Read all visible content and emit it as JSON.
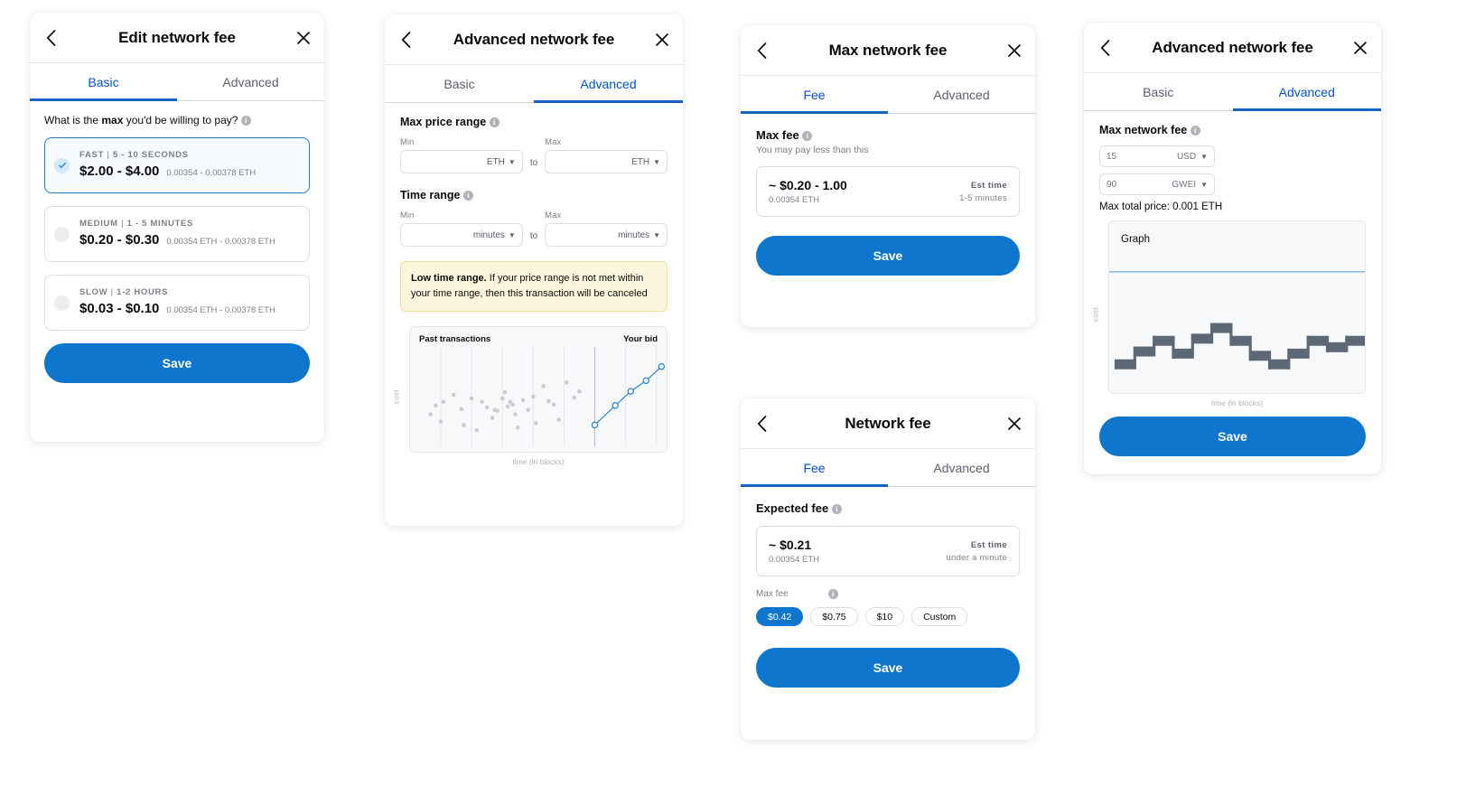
{
  "colors": {
    "accent_blue": "#0e76cc",
    "tab_active": "#0052cc",
    "tab_underline": "#1565c0",
    "warn_bg": "#fdf6dc",
    "warn_border": "#f2dfa0",
    "chart_bar": "#5d6876",
    "scatter_dot": "#c9ccd1",
    "line_blue": "#2d87d0"
  },
  "icons": {
    "back": "chevron-left-icon",
    "close": "close-icon",
    "info": "info-icon",
    "chevron_down": "chevron-down-icon",
    "check": "check-icon"
  },
  "card1": {
    "title": "Edit network fee",
    "tabs": [
      {
        "label": "Basic",
        "active": true
      },
      {
        "label": "Advanced",
        "active": false
      }
    ],
    "prompt_pre": "What is the ",
    "prompt_bold": "max",
    "prompt_post": " you'd be willing to pay?",
    "options": [
      {
        "speed": "FAST",
        "sep": " | ",
        "time": "5 - 10 SECONDS",
        "price": "$2.00 - $4.00",
        "eth": "0.00354 - 0.00378 ETH",
        "selected": true
      },
      {
        "speed": "MEDIUM",
        "sep": " | ",
        "time": "1 - 5 MINUTES",
        "price": "$0.20 - $0.30",
        "eth": "0.00354 ETH  - 0.00378 ETH",
        "selected": false
      },
      {
        "speed": "SLOW",
        "sep": " | ",
        "time": "1-2 HOURS",
        "price": "$0.03 - $0.10",
        "eth": "0.00354 ETH  - 0.00378 ETH",
        "selected": false
      }
    ],
    "save_label": "Save"
  },
  "card2": {
    "title": "Advanced network fee",
    "tabs": [
      {
        "label": "Basic",
        "active": false
      },
      {
        "label": "Advanced",
        "active": true
      }
    ],
    "price_section": {
      "title": "Max price range",
      "min_label": "Min",
      "max_label": "Max",
      "to_label": "to",
      "min_value": "",
      "min_unit": "ETH",
      "max_value": "",
      "max_unit": "ETH"
    },
    "time_section": {
      "title": "Time range",
      "min_label": "Min",
      "max_label": "Max",
      "to_label": "to",
      "min_value": "",
      "min_unit": "minutes",
      "max_value": "",
      "max_unit": "minutes"
    },
    "warning": {
      "bold": "Low time range.",
      "text": " If your price range is not met within your time range, then this transaction will be canceled"
    },
    "chart_data": {
      "type": "scatter",
      "title": "",
      "legend_left": "Past transactions",
      "legend_right": "Your bid",
      "xlabel": "time (in blocks)",
      "ylabel": "cost",
      "grid": true,
      "gridlines_x": [
        12,
        24,
        36,
        48,
        60,
        72,
        84,
        96
      ],
      "series": [
        {
          "name": "Past transactions",
          "type": "scatter",
          "points": [
            [
              8,
              30
            ],
            [
              10,
              40
            ],
            [
              12,
              22
            ],
            [
              13,
              44
            ],
            [
              17,
              52
            ],
            [
              20,
              36
            ],
            [
              21,
              18
            ],
            [
              24,
              48
            ],
            [
              26,
              12
            ],
            [
              28,
              44
            ],
            [
              30,
              38
            ],
            [
              32,
              26
            ],
            [
              33,
              35
            ],
            [
              34,
              34
            ],
            [
              36,
              48
            ],
            [
              37,
              55
            ],
            [
              38,
              39
            ],
            [
              39,
              44
            ],
            [
              40,
              41
            ],
            [
              41,
              30
            ],
            [
              42,
              15
            ],
            [
              44,
              46
            ],
            [
              46,
              35
            ],
            [
              48,
              50
            ],
            [
              49,
              20
            ],
            [
              52,
              62
            ],
            [
              54,
              45
            ],
            [
              56,
              41
            ],
            [
              58,
              24
            ],
            [
              61,
              66
            ],
            [
              64,
              49
            ],
            [
              66,
              56
            ]
          ]
        },
        {
          "name": "Your bid",
          "type": "line",
          "points": [
            [
              72,
              18
            ],
            [
              80,
              40
            ],
            [
              86,
              56
            ],
            [
              92,
              68
            ],
            [
              98,
              84
            ]
          ]
        }
      ]
    }
  },
  "card3": {
    "title": "Max network fee",
    "tabs": [
      {
        "label": "Fee",
        "active": true
      },
      {
        "label": "Advanced",
        "active": false
      }
    ],
    "heading": "Max fee",
    "subheading": "You may pay less than this",
    "fee_amount": "~ $0.20 - 1.00",
    "fee_eth": "0.00354 ETH",
    "est_label": "Est time",
    "est_value": "1-5 minutes",
    "save_label": "Save"
  },
  "card4": {
    "title": "Network fee",
    "tabs": [
      {
        "label": "Fee",
        "active": true
      },
      {
        "label": "Advanced",
        "active": false
      }
    ],
    "heading": "Expected fee",
    "fee_amount": "~ $0.21",
    "fee_eth": "0.00354 ETH",
    "est_label": "Est time",
    "est_value": "under a minute",
    "maxfee_label": "Max fee",
    "chips": [
      {
        "label": "$0.42",
        "active": true
      },
      {
        "label": "$0.75",
        "active": false
      },
      {
        "label": "$10",
        "active": false
      },
      {
        "label": "Custom",
        "active": false
      }
    ],
    "save_label": "Save"
  },
  "card5": {
    "title": "Advanced network fee",
    "tabs": [
      {
        "label": "Basic",
        "active": false
      },
      {
        "label": "Advanced",
        "active": true
      }
    ],
    "heading": "Max network fee",
    "inputs": [
      {
        "value": "15",
        "unit": "USD"
      },
      {
        "value": "90",
        "unit": "GWEI"
      }
    ],
    "total_text": "Max total price: 0.001 ETH",
    "graph_label": "Graph",
    "save_label": "Save",
    "chart_data": {
      "type": "bar",
      "title": "Graph",
      "xlabel": "time (in blocks)",
      "ylabel": "cost",
      "grid": false,
      "step_style": true,
      "threshold_line": 100,
      "categories": [
        "1",
        "2",
        "3",
        "4",
        "5",
        "6",
        "7",
        "8",
        "9",
        "10",
        "11",
        "12",
        "13"
      ],
      "values": [
        18,
        30,
        40,
        28,
        42,
        52,
        40,
        26,
        18,
        28,
        40,
        34,
        40
      ],
      "ylim": [
        0,
        110
      ]
    }
  }
}
